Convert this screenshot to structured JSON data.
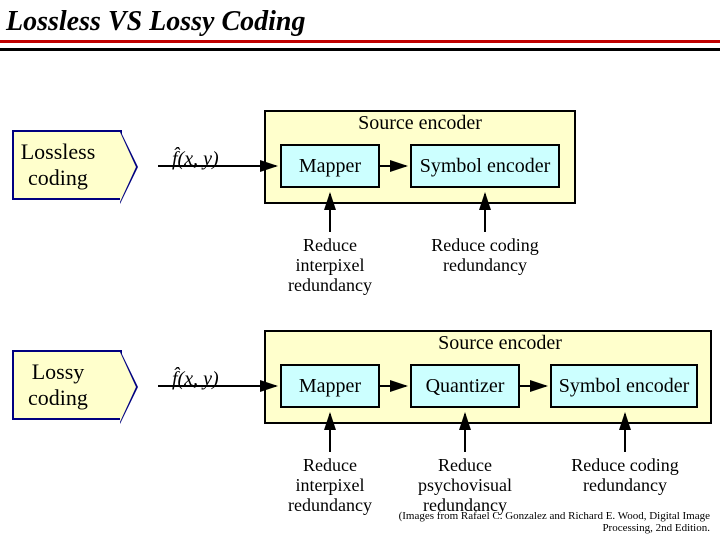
{
  "title": "Lossless VS Lossy Coding",
  "lossless": {
    "label": "Lossless\ncoding",
    "input": "f̂(x, y)",
    "encoder_label": "Source encoder",
    "stages": [
      "Mapper",
      "Symbol encoder"
    ],
    "captions": [
      "Reduce interpixel redundancy",
      "Reduce coding redundancy"
    ]
  },
  "lossy": {
    "label": "Lossy\ncoding",
    "input": "f̂(x, y)",
    "encoder_label": "Source encoder",
    "stages": [
      "Mapper",
      "Quantizer",
      "Symbol encoder"
    ],
    "captions": [
      "Reduce interpixel redundancy",
      "Reduce psychovisual redundancy",
      "Reduce coding redundancy"
    ]
  },
  "citation": "(Images from Rafael C. Gonzalez and Richard E. Wood, Digital Image Processing, 2nd Edition."
}
